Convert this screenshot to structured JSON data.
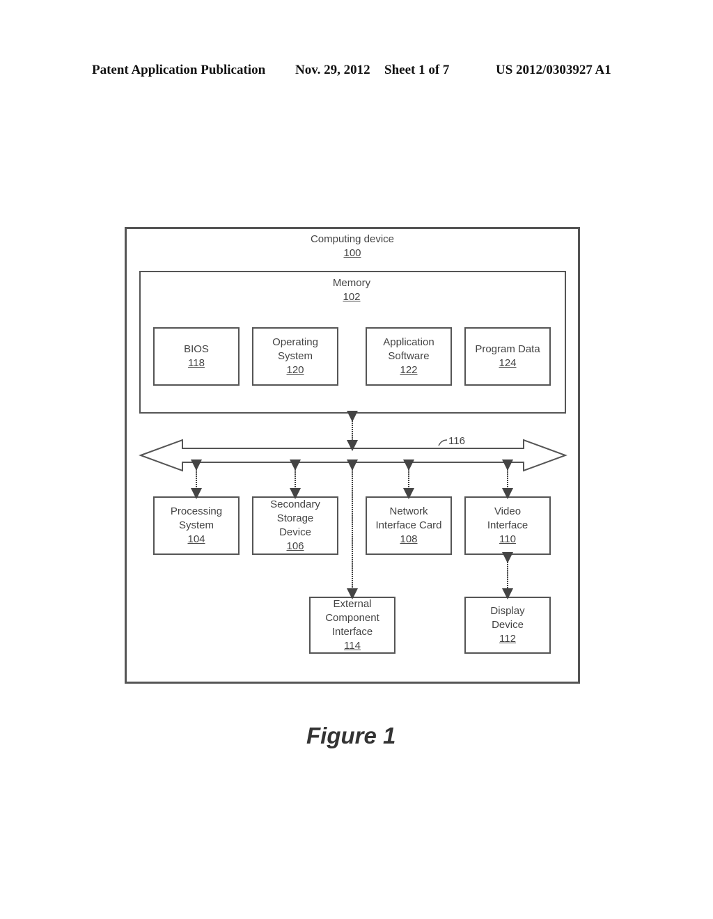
{
  "header": {
    "publication": "Patent Application Publication",
    "date": "Nov. 29, 2012",
    "sheet": "Sheet 1 of 7",
    "number": "US 2012/0303927 A1"
  },
  "diagram": {
    "outer": {
      "title": "Computing device",
      "ref": "100"
    },
    "memory": {
      "title": "Memory",
      "ref": "102"
    },
    "memory_blocks": [
      {
        "lines": [
          "BIOS"
        ],
        "ref": "118"
      },
      {
        "lines": [
          "Operating",
          "System"
        ],
        "ref": "120"
      },
      {
        "lines": [
          "Application",
          "Software"
        ],
        "ref": "122"
      },
      {
        "lines": [
          "Program Data"
        ],
        "ref": "124"
      }
    ],
    "bus": {
      "ref": "116"
    },
    "components": [
      {
        "lines": [
          "Processing",
          "System"
        ],
        "ref": "104"
      },
      {
        "lines": [
          "Secondary",
          "Storage",
          "Device"
        ],
        "ref": "106"
      },
      {
        "lines": [
          "Network",
          "Interface Card"
        ],
        "ref": "108"
      },
      {
        "lines": [
          "Video",
          "Interface"
        ],
        "ref": "110"
      }
    ],
    "external": {
      "lines": [
        "External",
        "Component",
        "Interface"
      ],
      "ref": "114"
    },
    "display": {
      "lines": [
        "Display",
        "Device"
      ],
      "ref": "112"
    }
  },
  "figure_caption": "Figure 1"
}
